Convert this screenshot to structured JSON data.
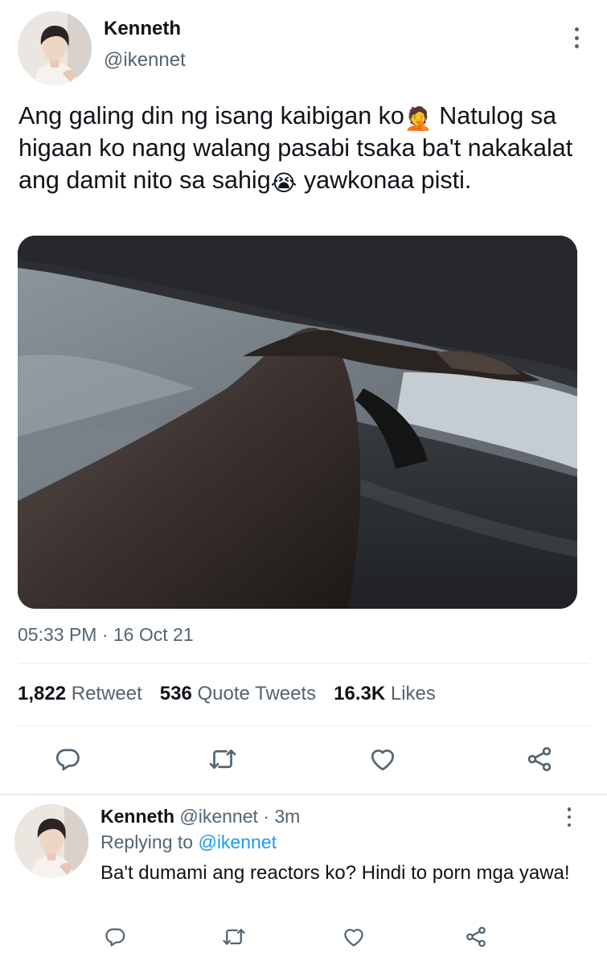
{
  "tweet": {
    "author_name": "Kenneth",
    "author_handle": "@ikennet",
    "text_part1": "Ang galing din ng isang kaibigan ko",
    "emoji1": "🤦",
    "text_part2": " Natulog sa higaan ko nang walang pasabi tsaka ba't nakakalat ang damit nito sa sahig",
    "emoji2": "😭",
    "text_part3": " yawkonaa pisti.",
    "timestamp": "05:33 PM · 16 Oct 21",
    "stats": {
      "retweets_count": "1,822",
      "retweets_label": "Retweet",
      "quotes_count": "536",
      "quotes_label": "Quote Tweets",
      "likes_count": "16.3K",
      "likes_label": "Likes"
    }
  },
  "reply": {
    "author_name": "Kenneth",
    "author_handle": "@ikennet",
    "time": "· 3m",
    "replying_prefix": "Replying to",
    "replying_to": "@ikennet",
    "text": "Ba't dumami ang reactors ko? Hindi to porn mga yawa!"
  },
  "icons": {
    "reply": "reply-icon",
    "retweet": "retweet-icon",
    "like": "heart-icon",
    "share": "share-icon",
    "more": "more-vertical-icon"
  },
  "colors": {
    "text": "#0f1419",
    "secondary": "#536471",
    "link": "#1d9bf0",
    "border": "#e6e9ec"
  }
}
